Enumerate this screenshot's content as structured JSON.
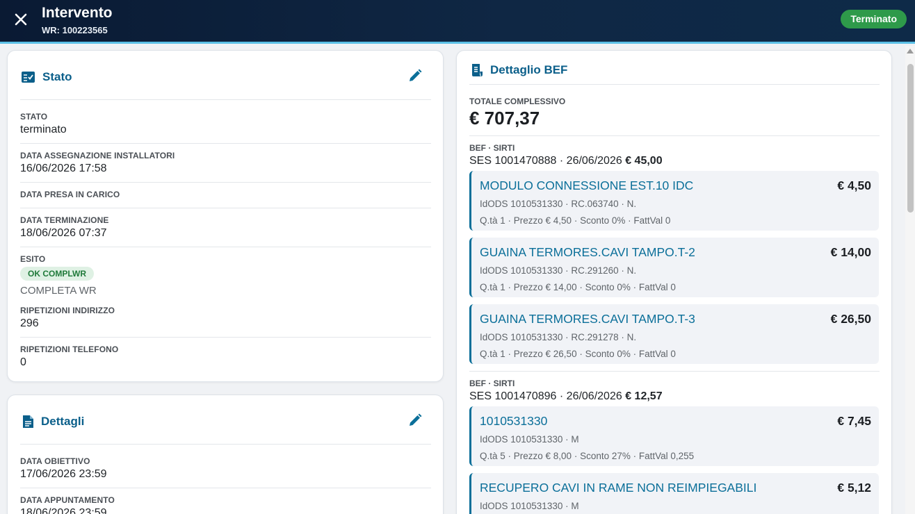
{
  "header": {
    "title": "Intervento",
    "subtitle": "WR: 100223565",
    "status_badge": "Terminato"
  },
  "stato_card": {
    "title": "Stato",
    "fields": [
      {
        "label": "STATO",
        "value": "terminato"
      },
      {
        "label": "DATA ASSEGNAZIONE INSTALLATORI",
        "value": "16/06/2026 17:58"
      },
      {
        "label": "DATA PRESA IN CARICO",
        "value": ""
      },
      {
        "label": "DATA TERMINAZIONE",
        "value": "18/06/2026 07:37"
      },
      {
        "label": "ESITO",
        "chip": "OK COMPLWR",
        "value": "COMPLETA WR"
      },
      {
        "label": "RIPETIZIONI INDIRIZZO",
        "value": "296"
      },
      {
        "label": "RIPETIZIONI TELEFONO",
        "value": "0"
      }
    ]
  },
  "dettagli_card": {
    "title": "Dettagli",
    "fields": [
      {
        "label": "DATA OBIETTIVO",
        "value": "17/06/2026 23:59"
      },
      {
        "label": "DATA APPUNTAMENTO",
        "value": "18/06/2026 23:59"
      }
    ]
  },
  "bef_card": {
    "title": "Dettaglio BEF",
    "total_label": "TOTALE COMPLESSIVO",
    "total_value": "€ 707,37",
    "groups": [
      {
        "label": "BEF · SIRTI",
        "ses": "SES 1001470888 · 26/06/2026",
        "amount": "€ 45,00",
        "items": [
          {
            "name": "MODULO CONNESSIONE EST.10 IDC",
            "price": "€ 4,50",
            "line1": "IdODS 1010531330 · RC.063740 · N.",
            "line2": "Q.tà 1 · Prezzo € 4,50 · Sconto 0% · FattVal 0"
          },
          {
            "name": "GUAINA TERMORES.CAVI TAMPO.T-2",
            "price": "€ 14,00",
            "line1": "IdODS 1010531330 · RC.291260 · N.",
            "line2": "Q.tà 1 · Prezzo € 14,00 · Sconto 0% · FattVal 0"
          },
          {
            "name": "GUAINA TERMORES.CAVI TAMPO.T-3",
            "price": "€ 26,50",
            "line1": "IdODS 1010531330 · RC.291278 · N.",
            "line2": "Q.tà 1 · Prezzo € 26,50 · Sconto 0% · FattVal 0"
          }
        ]
      },
      {
        "label": "BEF · SIRTI",
        "ses": "SES 1001470896 · 26/06/2026",
        "amount": "€ 12,57",
        "items": [
          {
            "name": "1010531330",
            "price": "€ 7,45",
            "line1": "IdODS 1010531330 · M",
            "line2": "Q.tà 5 · Prezzo € 8,00 · Sconto 27% · FattVal 0,255"
          },
          {
            "name": "RECUPERO CAVI IN RAME NON REIMPIEGABILI",
            "price": "€ 5,12",
            "line1": "IdODS 1010531330 · M",
            "line2": ""
          }
        ]
      }
    ]
  },
  "icons": {
    "close": "close-icon",
    "checklist": "checklist-icon",
    "document": "document-icon",
    "receipt": "receipt-icon",
    "edit": "pencil-icon"
  },
  "colors": {
    "header_bg": "#0f2744",
    "accent_line": "#5bc0e6",
    "accent": "#0b6f99",
    "status_green": "#2e9a4a"
  }
}
